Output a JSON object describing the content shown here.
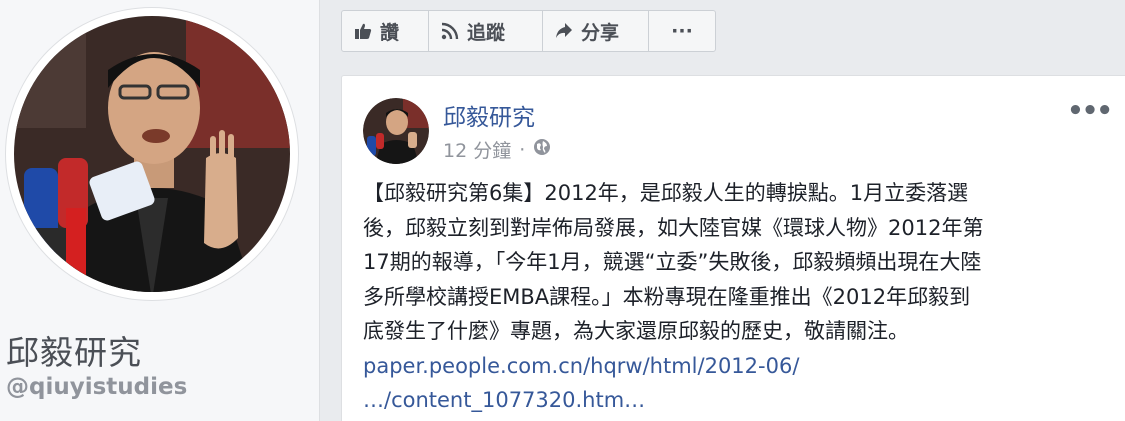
{
  "profile": {
    "name": "邱毅研究",
    "handle": "@qiuyistudies"
  },
  "actions": {
    "like_label": "讚",
    "follow_label": "追蹤",
    "share_label": "分享",
    "more_label": "···"
  },
  "post": {
    "author": "邱毅研究",
    "time": "12 分鐘",
    "separator": "·",
    "audience_icon": "globe-icon",
    "options_label": "•••",
    "body_lines": [
      "【邱毅研究第6集】2012年，是邱毅人生的轉捩點。1月立委落選",
      "後，邱毅立刻到對岸佈局發展，如大陸官媒《環球人物》2012年第",
      "17期的報導，「今年1月，競選“立委”失敗後，邱毅頻頻出現在大陸",
      "多所學校講授EMBA課程。」本粉專現在隆重推出《2012年邱毅到",
      "底發生了什麼》專題，為大家還原邱毅的歷史，敬請關注。"
    ],
    "link_lines": [
      "paper.people.com.cn/hqrw/html/2012-06/",
      "…/content_1077320.htm…"
    ]
  },
  "colors": {
    "link": "#365899",
    "background": "#e9ebee",
    "text": "#1d2129",
    "muted": "#90949c"
  }
}
